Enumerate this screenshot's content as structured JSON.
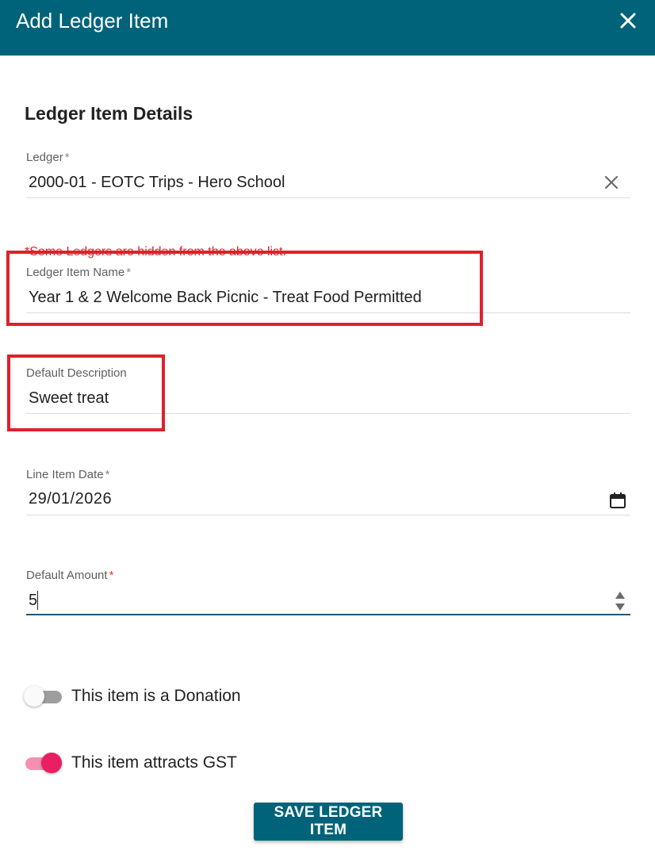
{
  "header": {
    "title": "Add Ledger Item",
    "close_icon": "close-icon"
  },
  "section": {
    "title": "Ledger Item Details"
  },
  "ledger": {
    "label": "Ledger",
    "required_mark": "*",
    "value": "2000-01 - EOTC Trips - Hero School",
    "clear_icon": "close-icon",
    "hint": "*Some Ledgers are hidden from the above list."
  },
  "item_name": {
    "label": "Ledger Item Name",
    "required_mark": "*",
    "value": "Year 1 & 2 Welcome Back Picnic - Treat Food Permitted"
  },
  "description": {
    "label": "Default Description",
    "value": "Sweet treat"
  },
  "date": {
    "label": "Line Item Date",
    "required_mark": "*",
    "value": "29/01/2026",
    "icon": "calendar-icon"
  },
  "amount": {
    "label": "Default Amount",
    "required_mark": "*",
    "value": "5",
    "icon": "spinner-arrows-icon"
  },
  "toggles": [
    {
      "label": "This item is a Donation",
      "checked": false
    },
    {
      "label": "This item attracts GST",
      "checked": true
    }
  ],
  "save_button": {
    "label": "SAVE LEDGER ITEM"
  },
  "colors": {
    "header_bg": "#00637a",
    "annotation_red": "#e0202a",
    "toggle_on": "#e91e63"
  }
}
